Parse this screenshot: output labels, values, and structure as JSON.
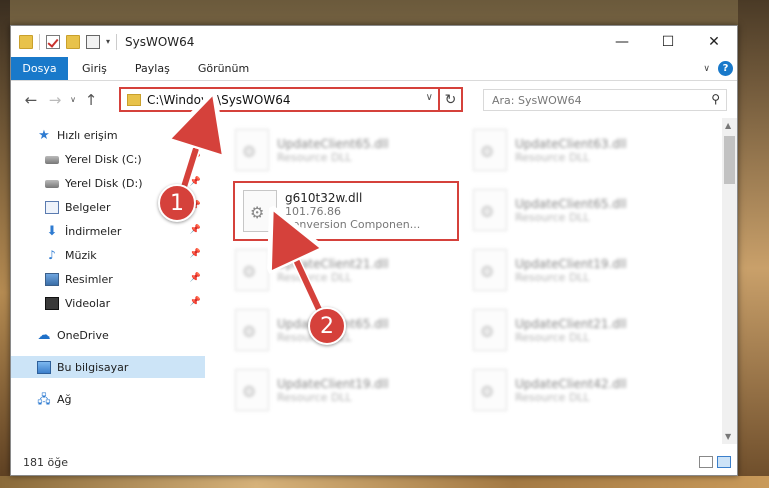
{
  "window": {
    "title": "SysWOW64",
    "controls": {
      "minimize": "—",
      "maximize": "☐",
      "close": "✕"
    }
  },
  "ribbon": {
    "tabs": [
      "Dosya",
      "Giriş",
      "Paylaş",
      "Görünüm"
    ]
  },
  "address": {
    "path": "C:\\Windows\\SysWOW64",
    "search_placeholder": "Ara: SysWOW64"
  },
  "sidebar": {
    "items": [
      {
        "label": "Hızlı erişim",
        "icon": "star-icon"
      },
      {
        "label": "Yerel Disk (C:)",
        "icon": "disk-icon"
      },
      {
        "label": "Yerel Disk (D:)",
        "icon": "disk-icon"
      },
      {
        "label": "Belgeler",
        "icon": "document-icon"
      },
      {
        "label": "İndirmeler",
        "icon": "download-icon"
      },
      {
        "label": "Müzik",
        "icon": "music-icon"
      },
      {
        "label": "Resimler",
        "icon": "pictures-icon"
      },
      {
        "label": "Videolar",
        "icon": "video-icon"
      },
      {
        "label": "OneDrive",
        "icon": "cloud-icon"
      },
      {
        "label": "Bu bilgisayar",
        "icon": "computer-icon"
      },
      {
        "label": "Ağ",
        "icon": "network-icon"
      }
    ]
  },
  "files": {
    "col1": [
      {
        "name": "UpdateClient65.dll",
        "type": "Resource DLL"
      },
      {
        "name": "g610t32w.dll",
        "version": "101.76.86",
        "type": "Conversion Componen..."
      },
      {
        "name": "UpdateClient21.dll",
        "type": "Resource DLL"
      },
      {
        "name": "UpdateClient65.dll",
        "type": "Resource DLL"
      },
      {
        "name": "UpdateClient19.dll",
        "type": "Resource DLL"
      }
    ],
    "col2": [
      {
        "name": "UpdateClient63.dll",
        "type": "Resource DLL"
      },
      {
        "name": "UpdateClient65.dll",
        "type": "Resource DLL"
      },
      {
        "name": "UpdateClient19.dll",
        "type": "Resource DLL"
      },
      {
        "name": "UpdateClient21.dll",
        "type": "Resource DLL"
      },
      {
        "name": "UpdateClient42.dll",
        "type": "Resource DLL"
      }
    ]
  },
  "status": {
    "count": "181 öğe"
  },
  "callouts": [
    "1",
    "2"
  ],
  "colors": {
    "accent": "#1979ca",
    "highlight": "#d5413b",
    "selected": "#cce4f7"
  }
}
